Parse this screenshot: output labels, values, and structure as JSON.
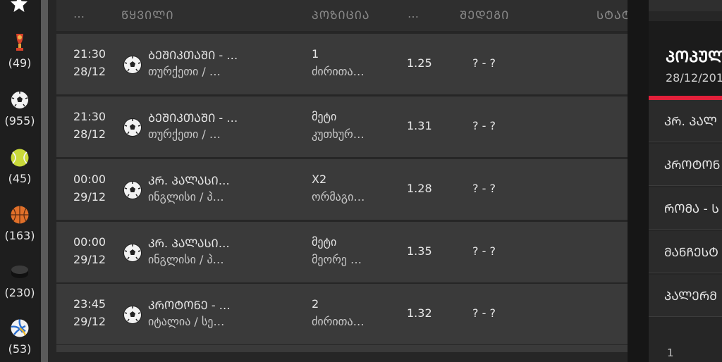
{
  "sidebar": {
    "favorites_icon": "star-icon",
    "sports": [
      {
        "icon": "worldcup-trophy-icon",
        "count": "(49)"
      },
      {
        "icon": "soccer-ball-icon",
        "count": "(955)"
      },
      {
        "icon": "tennis-ball-icon",
        "count": "(45)"
      },
      {
        "icon": "basketball-icon",
        "count": "(163)"
      },
      {
        "icon": "hockey-puck-icon",
        "count": "(230)"
      },
      {
        "icon": "volleyball-icon",
        "count": "(53)"
      }
    ]
  },
  "table": {
    "headers": {
      "col1": "…",
      "event": "ᲬᲧᲕᲘᲚᲘ",
      "position": "ᲞᲝᲖᲘᲪᲘᲐ",
      "col4": "…",
      "result": "ᲨᲔᲓᲔᲒᲘ",
      "status": "ᲡᲢᲐᲢ"
    },
    "rows": [
      {
        "time": "21:30",
        "date": "28/12",
        "match": "ᲑᲔᲨᲘᲙᲗᲐᲨᲘ - …",
        "league": "თურქეთი / …",
        "pick": "1",
        "market": "ძირითა…",
        "odds": "1.25",
        "result": "? - ?"
      },
      {
        "time": "21:30",
        "date": "28/12",
        "match": "ᲑᲔᲨᲘᲙᲗᲐᲨᲘ - …",
        "league": "თურქეთი / …",
        "pick": "მეტი",
        "market": "კუთხურ…",
        "odds": "1.31",
        "result": "? - ?"
      },
      {
        "time": "00:00",
        "date": "29/12",
        "match": "ᲙᲠ. ᲞᲐᲚᲐᲡᲘ…",
        "league": "ინგლისი / პ…",
        "pick": "X2",
        "market": "ორმაგი…",
        "odds": "1.28",
        "result": "? - ?"
      },
      {
        "time": "00:00",
        "date": "29/12",
        "match": "ᲙᲠ. ᲞᲐᲚᲐᲡᲘ…",
        "league": "ინგლისი / პ…",
        "pick": "მეტი",
        "market": "მეორე …",
        "odds": "1.35",
        "result": "? - ?"
      },
      {
        "time": "23:45",
        "date": "29/12",
        "match": "ᲙᲠᲝᲢᲝᲜᲔ - …",
        "league": "იტალია / სე…",
        "pick": "2",
        "market": "ძირითა…",
        "odds": "1.32",
        "result": "? - ?"
      }
    ]
  },
  "popular": {
    "title": "ᲞᲝᲞᲣᲚ",
    "date": "28/12/201",
    "items": [
      "ᲙᲠ. ᲞᲐᲚ",
      "ᲙᲠᲝᲢᲝᲜ",
      "ᲠᲝᲛᲐ - Ს",
      "ᲛᲐᲜᲩᲔᲡᲢ",
      "ᲞᲐᲚᲔᲠᲛ"
    ],
    "page": "1"
  },
  "colors": {
    "accent": "#e2203a",
    "row": "#3a3a3a",
    "background": "#262626"
  }
}
